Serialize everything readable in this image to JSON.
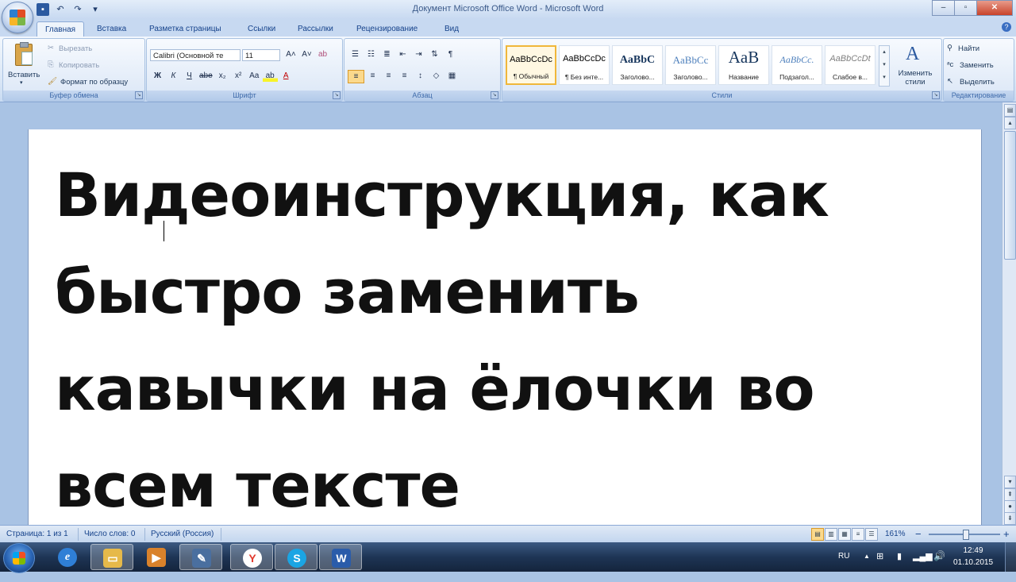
{
  "window": {
    "title": "Документ Microsoft Office Word - Microsoft Word",
    "controls": {
      "minimize": "–",
      "maximize": "▫",
      "close": "✕"
    }
  },
  "quick_access": [
    {
      "name": "save-icon",
      "glyph": "💾"
    },
    {
      "name": "undo-icon",
      "glyph": "↶"
    },
    {
      "name": "redo-icon",
      "glyph": "↷"
    },
    {
      "name": "qat-dropdown-icon",
      "glyph": "▾"
    }
  ],
  "tabs": [
    "Главная",
    "Вставка",
    "Разметка страницы",
    "Ссылки",
    "Рассылки",
    "Рецензирование",
    "Вид"
  ],
  "active_tab": "Главная",
  "ribbon": {
    "clipboard": {
      "label": "Буфер обмена",
      "paste": "Вставить",
      "cut": "Вырезать",
      "copy": "Копировать",
      "format_painter": "Формат по образцу"
    },
    "font": {
      "label": "Шрифт",
      "font_name": "Calibri (Основной те",
      "font_size": "11",
      "grow": "A˄",
      "shrink": "A˅",
      "clear": "ab",
      "bold": "Ж",
      "italic": "К",
      "underline": "Ч",
      "strike": "abe",
      "subscript": "x₂",
      "superscript": "x²",
      "case": "Aa",
      "highlight": "ab",
      "color": "A"
    },
    "paragraph": {
      "label": "Абзац",
      "pilcrow": "¶"
    },
    "styles": {
      "label": "Стили",
      "change": "Изменить стили",
      "items": [
        {
          "sample": "AaBbCcDc",
          "name": "¶ Обычный"
        },
        {
          "sample": "AaBbCcDc",
          "name": "¶ Без инте..."
        },
        {
          "sample": "AaBbC",
          "name": "Заголово..."
        },
        {
          "sample": "AaBbCc",
          "name": "Заголово..."
        },
        {
          "sample": "AaB",
          "name": "Название"
        },
        {
          "sample": "AaBbCc.",
          "name": "Подзагол..."
        },
        {
          "sample": "AaBbCcDt",
          "name": "Слабое в..."
        }
      ]
    },
    "editing": {
      "label": "Редактирование",
      "find": "Найти",
      "replace": "Заменить",
      "select": "Выделить"
    }
  },
  "document": {
    "lines": [
      "Видеоинструкция, как",
      "быстро заменить",
      "кавычки на ёлочки во",
      "всем тексте"
    ]
  },
  "status": {
    "page": "Страница: 1 из 1",
    "words": "Число слов: 0",
    "language": "Русский (Россия)",
    "zoom": "161%",
    "zoom_minus": "−",
    "zoom_plus": "+"
  },
  "taskbar": {
    "apps": [
      {
        "name": "internet-explorer-icon",
        "glyph": "e",
        "color": "#2f7fd6"
      },
      {
        "name": "folder-icon",
        "glyph": "▭",
        "color": "#e6b94a"
      },
      {
        "name": "media-player-icon",
        "glyph": "▶",
        "color": "#d9822b"
      },
      {
        "name": "drawing-app-icon",
        "glyph": "✎",
        "color": "#4a6f9f"
      },
      {
        "name": "yandex-browser-icon",
        "glyph": "Y",
        "color": "#e23a2e"
      },
      {
        "name": "skype-icon",
        "glyph": "S",
        "color": "#1aa5e4"
      },
      {
        "name": "word-icon",
        "glyph": "W",
        "color": "#2a5caa"
      }
    ],
    "lang": "RU",
    "time": "12:49",
    "date": "01.10.2015"
  }
}
